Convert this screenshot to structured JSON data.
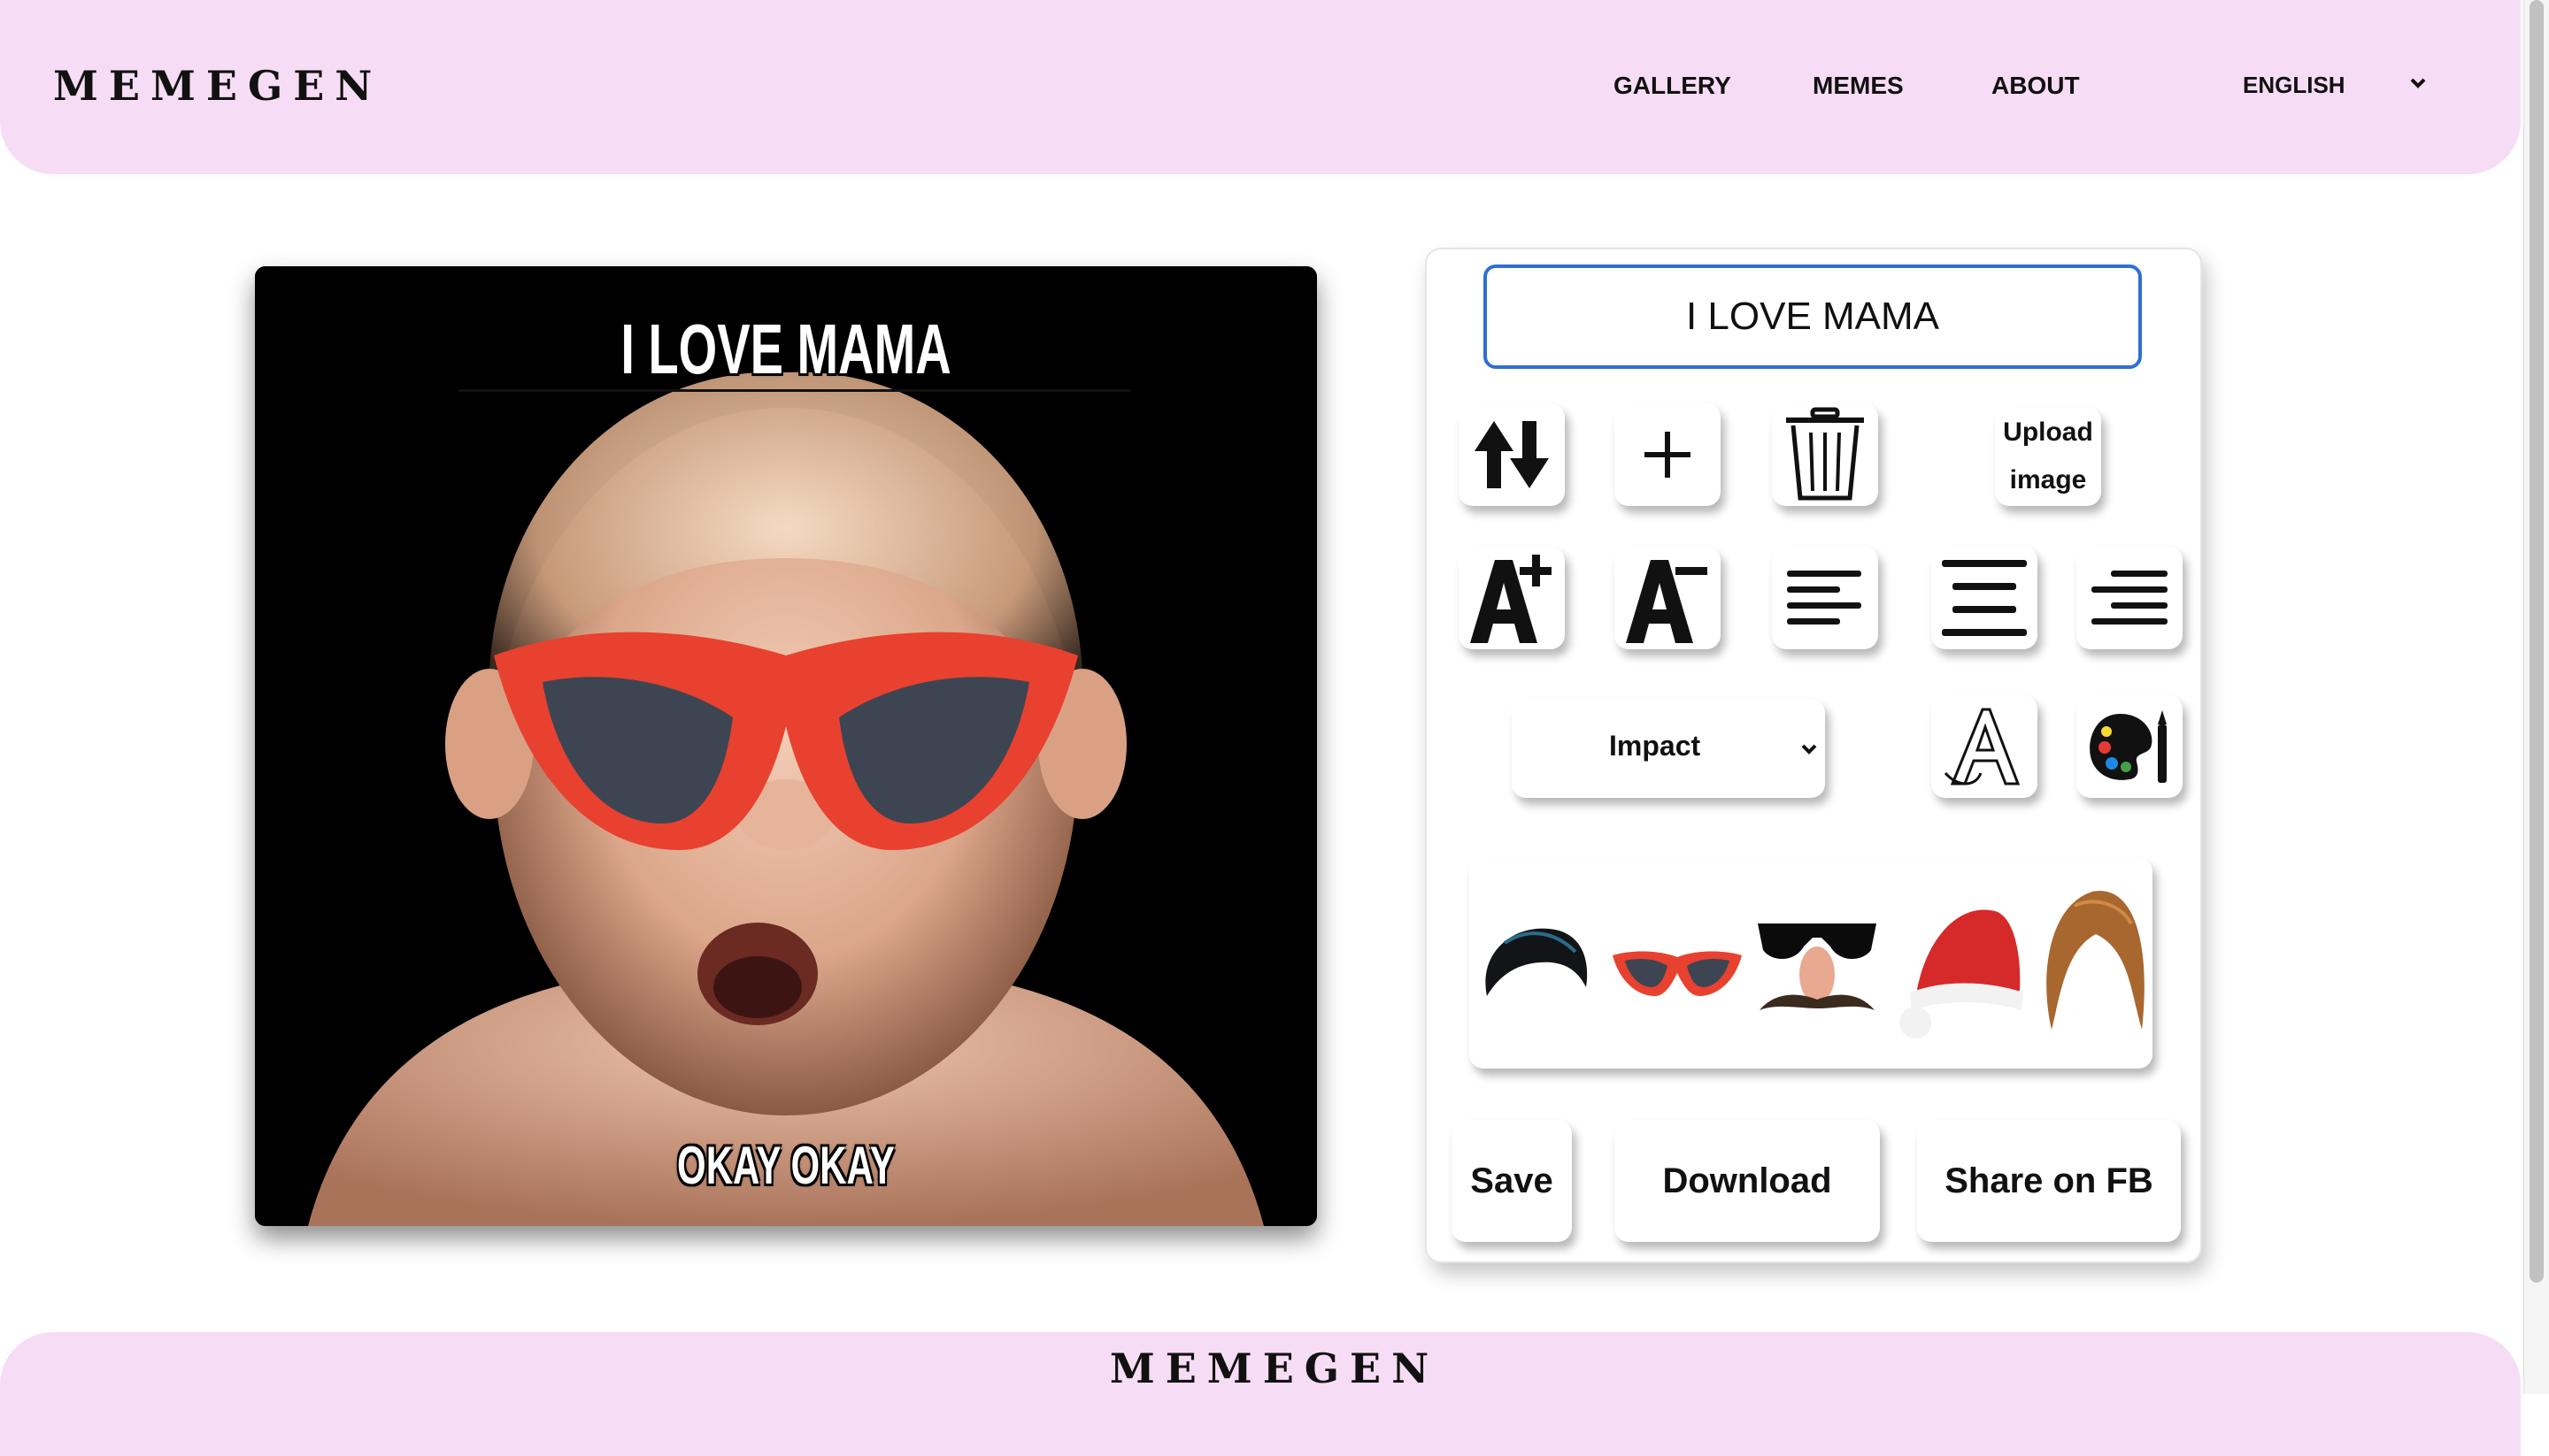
{
  "header": {
    "brand": "MEMEGEN",
    "nav": [
      "GALLERY",
      "MEMES",
      "ABOUT"
    ],
    "language": "ENGLISH"
  },
  "meme": {
    "top_text": "I LOVE MAMA",
    "bottom_text": "OKAY OKAY"
  },
  "editor": {
    "text_input_value": "I LOVE MAMA",
    "upload_label_line1": "Upload",
    "upload_label_line2": "image",
    "font_selected": "Impact",
    "stickers": [
      "hair-black-icon",
      "red-sunglasses-icon",
      "disguise-glasses-icon",
      "santa-hat-icon",
      "hair-brown-icon"
    ],
    "actions": {
      "save": "Save",
      "download": "Download",
      "share": "Share on FB"
    }
  },
  "footer": {
    "brand": "MEMEGEN"
  },
  "colors": {
    "header_bg": "#f6dcf4",
    "accent_input": "#2f6fd6",
    "sunglasses_red": "#e8412f"
  }
}
